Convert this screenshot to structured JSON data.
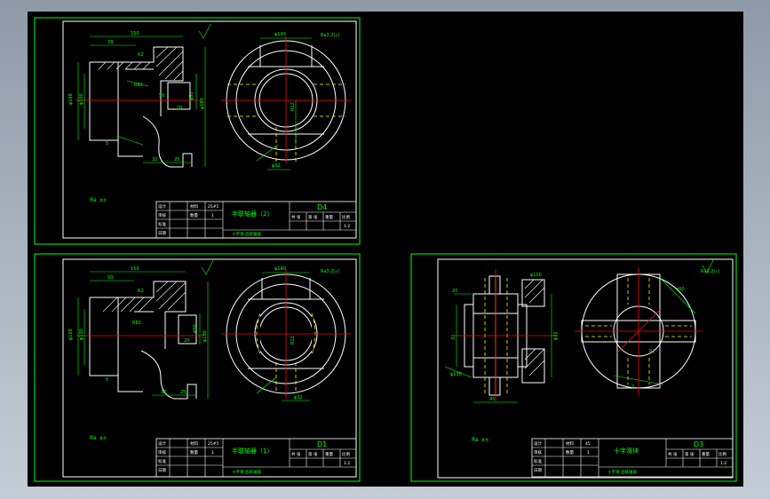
{
  "sheets": [
    {
      "id": "d4",
      "drawing_code": "D4",
      "part_name": "半联轴器（2）",
      "material": "25#5",
      "quantity": "1",
      "mark": "Ra3.2(√)",
      "roughness": "Ra",
      "rough_other": "其余",
      "footer": "十字滑 齿联轴器",
      "tb_labels": [
        "设计",
        "审核",
        "标准",
        "日期"
      ],
      "tb_cols": [
        "材料",
        "数量"
      ],
      "tb_right_labels": [
        "共 张",
        "第 张",
        "重量",
        "比例"
      ],
      "scale": "1:2",
      "dims": [
        "150",
        "78",
        "R2",
        "R82",
        "50",
        "5",
        "φ168",
        "φ100",
        "φ50",
        "φ180",
        "32",
        "25",
        "20",
        "φ140",
        "R12",
        "φ32"
      ]
    },
    {
      "id": "d1",
      "drawing_code": "D1",
      "part_name": "半联轴器（1）",
      "material": "25#5",
      "quantity": "1",
      "mark": "Ra3.2(√)",
      "roughness": "Ra",
      "rough_other": "其余",
      "footer": "十字滑 齿联轴器",
      "tb_labels": [
        "设计",
        "审核",
        "标准",
        "日期"
      ],
      "tb_cols": [
        "材料",
        "数量"
      ],
      "tb_right_labels": [
        "共 张",
        "第 张",
        "重量",
        "比例"
      ],
      "scale": "1:2",
      "dims": [
        "150",
        "50",
        "R2",
        "R82",
        "5",
        "φ168",
        "φ100",
        "φ50",
        "φ180",
        "32",
        "25",
        "20",
        "φ140",
        "R12",
        "φ32"
      ]
    },
    {
      "id": "d3",
      "drawing_code": "D3",
      "part_name": "十字滑块",
      "material": "45",
      "quantity": "1",
      "mark": "Ra3.2(√)",
      "roughness": "Ra",
      "rough_other": "其余",
      "footer": "十字滑 齿联轴器",
      "tb_labels": [
        "设计",
        "审核",
        "标准",
        "日期"
      ],
      "tb_cols": [
        "材料",
        "数量"
      ],
      "tb_right_labels": [
        "共 张",
        "第 张",
        "重量",
        "比例"
      ],
      "scale": "1:2",
      "dims": [
        "20",
        "32",
        "45",
        "φ32",
        "φ130",
        "φ60",
        "R2",
        "φ100",
        "2"
      ]
    }
  ],
  "colors": {
    "background": "#000000",
    "frame": "#00ff00",
    "inner_border": "#ffffff",
    "center_line": "#ff0000",
    "hidden_line": "#ffff00",
    "dimension": "#00ff00",
    "title_text": "#00ff00"
  }
}
